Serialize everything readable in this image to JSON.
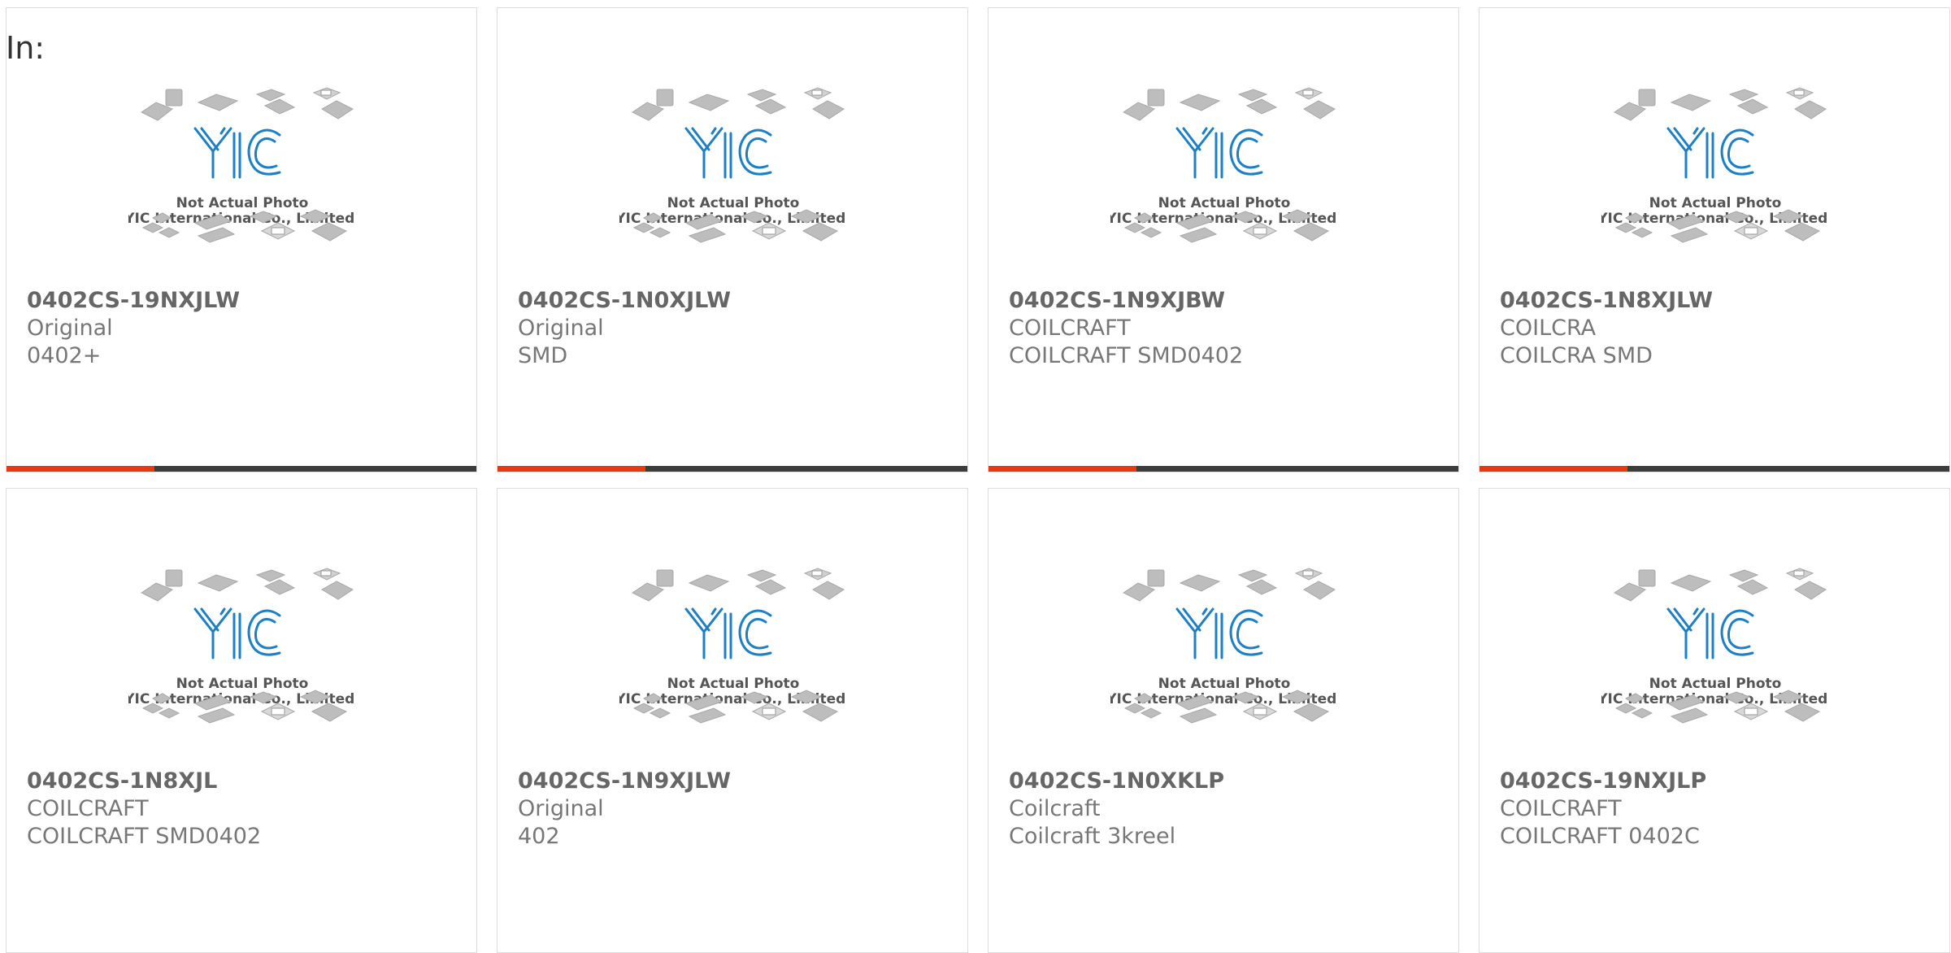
{
  "page": {
    "in_label": "In:"
  },
  "placeholder": {
    "line1": "Not Actual Photo",
    "line2": "YIC International Co., Limited.",
    "logo_text": "YIC"
  },
  "colors": {
    "accent": "#e8380d",
    "bar": "#3c3c3c",
    "logo_blue": "#1e7fc4"
  },
  "products": [
    {
      "part": "0402CS-19NXJLW",
      "line1": "Original",
      "line2": "0402+",
      "bar": true
    },
    {
      "part": "0402CS-1N0XJLW",
      "line1": "Original",
      "line2": "SMD",
      "bar": true
    },
    {
      "part": "0402CS-1N9XJBW",
      "line1": "COILCRAFT",
      "line2": "COILCRAFT SMD0402",
      "bar": true
    },
    {
      "part": "0402CS-1N8XJLW",
      "line1": "COILCRA",
      "line2": "COILCRA SMD",
      "bar": true
    },
    {
      "part": "0402CS-1N8XJL",
      "line1": "COILCRAFT",
      "line2": "COILCRAFT SMD0402",
      "bar": false
    },
    {
      "part": "0402CS-1N9XJLW",
      "line1": "Original",
      "line2": "402",
      "bar": false
    },
    {
      "part": "0402CS-1N0XKLP",
      "line1": "Coilcraft",
      "line2": "Coilcraft 3kreel",
      "bar": false
    },
    {
      "part": "0402CS-19NXJLP",
      "line1": "COILCRAFT",
      "line2": "COILCRAFT 0402C",
      "bar": false
    }
  ]
}
